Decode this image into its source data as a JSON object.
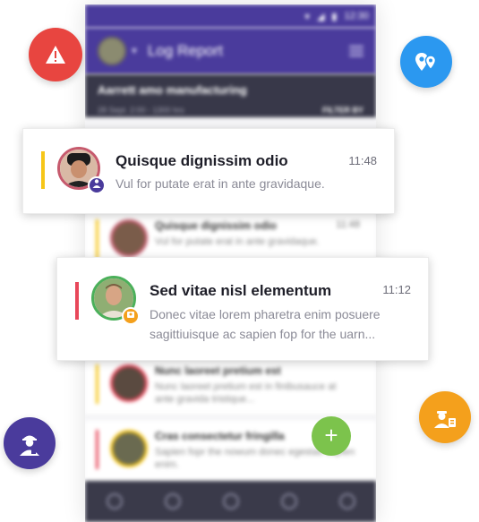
{
  "status": {
    "time": "12:30"
  },
  "app": {
    "title": "Log Report"
  },
  "subheader": {
    "title": "Aarrett amo manufacturing",
    "date": "28 Sept. 2:00 - 1300 hrs",
    "filter": "FILTER BY"
  },
  "bg_items": [
    {
      "title": "Quisque dignissim odio",
      "body": "Vul for putate erat in ante gravidaque.",
      "time": "11:48"
    },
    {
      "title": "Nunc laoreet pretium est",
      "body": "Nunc laoreet pretium est in finibusauce at ante gravida tristique...",
      "time": ""
    },
    {
      "title": "Cras consectetur fringilla",
      "body": "Sapien fopr the nowum donec egestas sapien enim.",
      "time": ""
    }
  ],
  "cards": [
    {
      "title": "Quisque dignissim odio",
      "body": "Vul for putate erat in ante gravidaque.",
      "time": "11:48"
    },
    {
      "title": "Sed vitae nisl elementum",
      "body_line1": "Donec vitae lorem pharetra enim posuere",
      "body_line2": "sagittiuisque ac sapien fop for the uarn...",
      "time": "11:12"
    }
  ],
  "icons": {
    "warning": "warning-icon",
    "location": "location-pins-icon",
    "worker": "worker-icon",
    "manager": "manager-icon"
  },
  "colors": {
    "primary": "#4a3b9c",
    "warning_red": "#e84540",
    "location_blue": "#2b98f0",
    "worker_purple": "#4a3b9c",
    "manager_orange": "#f4a01c",
    "accent_yellow": "#f6c618",
    "accent_red": "#e8475a",
    "fab_green": "#7cc34c"
  }
}
